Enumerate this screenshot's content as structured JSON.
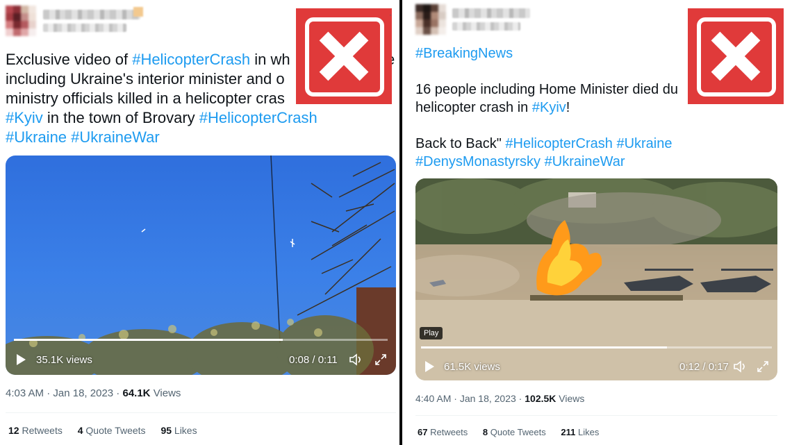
{
  "left_tweet": {
    "text_lines": [
      [
        {
          "t": "Exclusive video of ",
          "h": false
        },
        {
          "t": "#HelicopterCrash",
          "h": true
        },
        {
          "t": " in wh",
          "h": false
        }
      ],
      [
        {
          "t": "including Ukraine's interior minister and o",
          "h": false
        }
      ],
      [
        {
          "t": "ministry officials killed in a helicopter cras",
          "h": false
        }
      ],
      [
        {
          "t": "#Kyiv",
          "h": true
        },
        {
          "t": " in the town of Brovary ",
          "h": false
        },
        {
          "t": "#HelicopterCrash",
          "h": true
        }
      ],
      [
        {
          "t": "#Ukraine",
          "h": true
        },
        {
          "t": " ",
          "h": false
        },
        {
          "t": "#UkraineWar",
          "h": true
        }
      ]
    ],
    "trailing_fragment": "e",
    "video": {
      "views": "35.1K views",
      "time": "0:08 / 0:11",
      "progress": 0.72
    },
    "meta": {
      "time": "4:03 AM",
      "date": "Jan 18, 2023",
      "views_count": "64.1K",
      "views_label": "Views"
    },
    "stats": [
      {
        "count": "12",
        "label": "Retweets"
      },
      {
        "count": "4",
        "label": "Quote Tweets"
      },
      {
        "count": "95",
        "label": "Likes"
      }
    ]
  },
  "right_tweet": {
    "text_lines": [
      [
        {
          "t": "#BreakingNews",
          "h": true
        }
      ],
      [],
      [
        {
          "t": "16 people including Home Minister died du",
          "h": false
        }
      ],
      [
        {
          "t": "helicopter crash in ",
          "h": false
        },
        {
          "t": "#Kyiv",
          "h": true
        },
        {
          "t": "!",
          "h": false
        }
      ],
      [],
      [
        {
          "t": " Back to Back\" ",
          "h": false
        },
        {
          "t": "#HelicopterCrash",
          "h": true
        },
        {
          "t": " ",
          "h": false
        },
        {
          "t": "#Ukraine",
          "h": true
        }
      ],
      [
        {
          "t": "#DenysMonastyrsky",
          "h": true
        },
        {
          "t": " ",
          "h": false
        },
        {
          "t": "#UkraineWar",
          "h": true
        }
      ]
    ],
    "video": {
      "play_tag": "Play",
      "views": "61.5K views",
      "time": "0:12 / 0:17",
      "progress": 0.7
    },
    "meta": {
      "time": "4:40 AM",
      "date": "Jan 18, 2023",
      "views_count": "102.5K",
      "views_label": "Views"
    },
    "stats": [
      {
        "count": "67",
        "label": "Retweets"
      },
      {
        "count": "8",
        "label": "Quote Tweets"
      },
      {
        "count": "211",
        "label": "Likes"
      }
    ]
  },
  "colors": {
    "hashtag": "#1d9bf0",
    "fact_check_red": "#e03a3a",
    "divider": "#000000"
  },
  "icons": [
    "false-x-icon",
    "play-icon",
    "volume-icon",
    "fullscreen-icon"
  ]
}
